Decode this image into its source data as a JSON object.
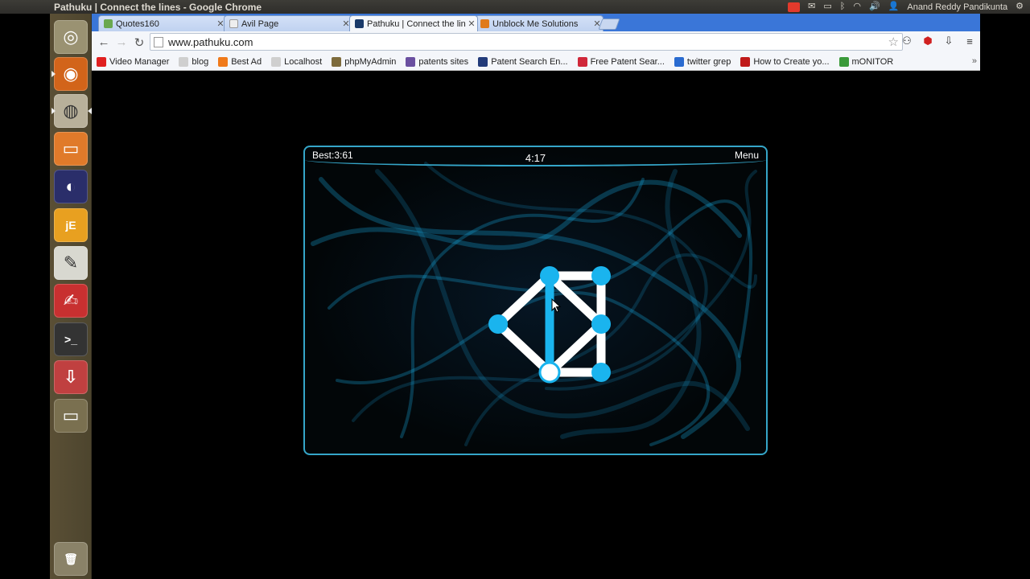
{
  "window": {
    "title": "Pathuku | Connect the lines - Google Chrome"
  },
  "system_tray": {
    "user": "Anand Reddy Pandikunta"
  },
  "tabs": [
    {
      "label": "Quotes160",
      "active": false
    },
    {
      "label": "Avil Page",
      "active": false
    },
    {
      "label": "Pathuku | Connect the lin",
      "active": true
    },
    {
      "label": "Unblock Me Solutions",
      "active": false
    }
  ],
  "omnibox": {
    "url": "www.pathuku.com"
  },
  "bookmarks": [
    {
      "label": "Video Manager",
      "color": "#e02020"
    },
    {
      "label": "blog",
      "color": "#cfcfcf"
    },
    {
      "label": "Best Ad",
      "color": "#f07a1a"
    },
    {
      "label": "Localhost",
      "color": "#cfcfcf"
    },
    {
      "label": "phpMyAdmin",
      "color": "#7d6b3c"
    },
    {
      "label": "patents sites",
      "color": "#6a4fa0"
    },
    {
      "label": "Patent Search En...",
      "color": "#223b7a"
    },
    {
      "label": "Free Patent Sear...",
      "color": "#d0283a"
    },
    {
      "label": "twitter grep",
      "color": "#2a6bd0"
    },
    {
      "label": "How to Create yo...",
      "color": "#c01a1a"
    },
    {
      "label": "mONITOR",
      "color": "#3a9a3a"
    }
  ],
  "launcher_items": [
    {
      "name": "ubuntu-dash-icon",
      "bg": "#9a9272",
      "glyph": "◎"
    },
    {
      "name": "firefox-icon",
      "bg": "#d2641a",
      "glyph": "◉"
    },
    {
      "name": "chrome-icon",
      "bg": "#b8b09a",
      "glyph": "◍"
    },
    {
      "name": "files-icon",
      "bg": "#e07a2a",
      "glyph": "▭"
    },
    {
      "name": "eclipse-icon",
      "bg": "#2a2e6a",
      "glyph": "◐"
    },
    {
      "name": "jedit-icon",
      "bg": "#e8a020",
      "glyph": "jE"
    },
    {
      "name": "text-editor-icon",
      "bg": "#d8d8d0",
      "glyph": "✎"
    },
    {
      "name": "pdf-viewer-icon",
      "bg": "#c83030",
      "glyph": "✍"
    },
    {
      "name": "terminal-icon",
      "bg": "#333333",
      "glyph": ">_"
    },
    {
      "name": "installer-icon",
      "bg": "#c04040",
      "glyph": "⇩"
    },
    {
      "name": "workspace-icon",
      "bg": "#7a7050",
      "glyph": "▭"
    },
    {
      "name": "trash-icon",
      "bg": "#8a8268",
      "glyph": "🗑"
    }
  ],
  "game": {
    "best_label": "Best:3:61",
    "timer": "4:17",
    "menu_label": "Menu",
    "accent": "#1ab4ee",
    "line_color": "#ffffff",
    "edges_done": [
      [
        "a",
        "e"
      ]
    ],
    "edges_remaining": [
      [
        "a",
        "b"
      ],
      [
        "b",
        "c"
      ],
      [
        "c",
        "d"
      ],
      [
        "d",
        "e"
      ],
      [
        "e",
        "f"
      ],
      [
        "f",
        "a"
      ],
      [
        "a",
        "c"
      ],
      [
        "c",
        "e"
      ]
    ],
    "current_node": "e"
  }
}
